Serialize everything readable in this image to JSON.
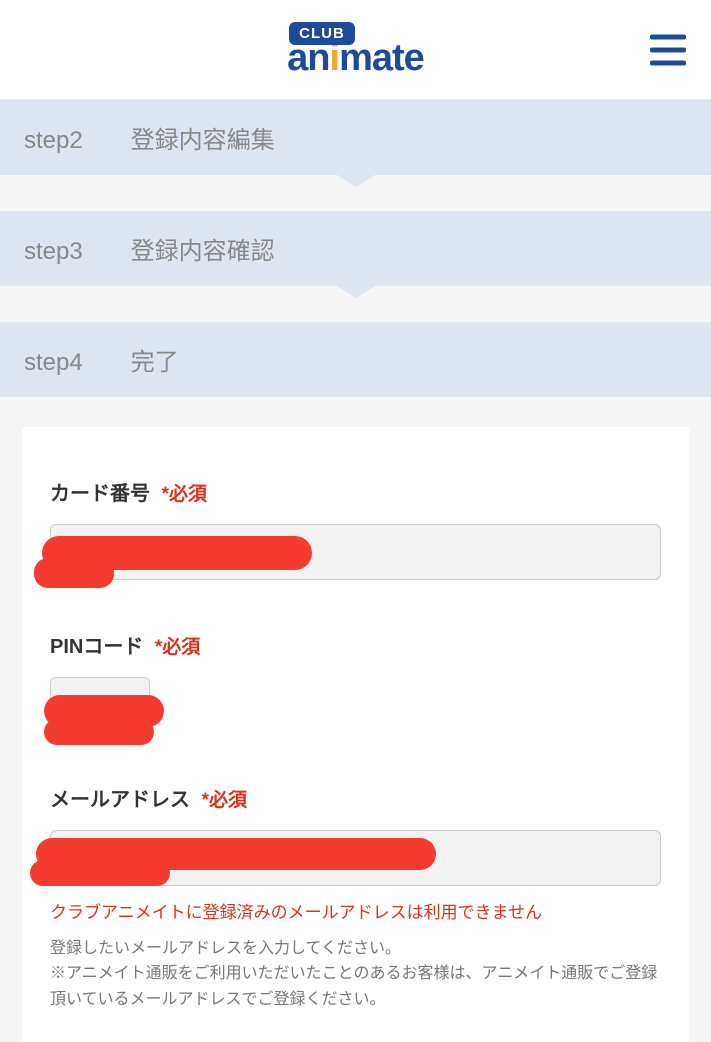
{
  "header": {
    "logo_club": "CLUB",
    "logo_main_pre": "an",
    "logo_main_i": "i",
    "logo_main_post": "mate"
  },
  "steps": [
    {
      "label": "step2",
      "text": "登録内容編集"
    },
    {
      "label": "step3",
      "text": "登録内容確認"
    },
    {
      "label": "step4",
      "text": "完了"
    }
  ],
  "form": {
    "required_mark": "*必須",
    "card": {
      "label": "カード番号",
      "value": ""
    },
    "pin": {
      "label": "PINコード",
      "value": ""
    },
    "email": {
      "label": "メールアドレス",
      "value": "",
      "error": "クラブアニメイトに登録済みのメールアドレスは利用できません",
      "help1": "登録したいメールアドレスを入力してください。",
      "help2": "※アニメイト通販をご利用いただいたことのあるお客様は、アニメイト通販でご登録頂いているメールアドレスでご登録ください。"
    }
  }
}
